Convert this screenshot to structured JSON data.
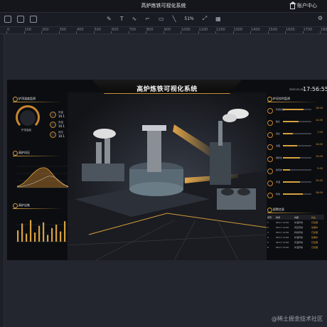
{
  "window": {
    "title": "高炉炼铁可视化系统",
    "account_label": "账户中心"
  },
  "toolbar": {
    "zoom": "51%",
    "left_icons": [
      "menu-icon",
      "layers-icon",
      "undo-icon"
    ],
    "center_icons": [
      "pen-icon",
      "text-icon",
      "curve-icon",
      "connector-icon"
    ],
    "right_icons": [
      "settings-icon"
    ]
  },
  "ruler": {
    "ticks": [
      "0",
      "100",
      "200",
      "300",
      "400",
      "500",
      "600",
      "700",
      "800",
      "900",
      "1000",
      "1100",
      "1200",
      "1300",
      "1400",
      "1500",
      "1600",
      "1700",
      "1800"
    ]
  },
  "dashboard": {
    "title": "高炉炼铁可视化系统",
    "date": "2022-01-05",
    "time": "17:56:55",
    "left_panels": {
      "gauge_title": "炉顶温度监测",
      "gauge_label": "炉顶温度",
      "stats": [
        {
          "label": "风量",
          "value": "10.1"
        },
        {
          "label": "风温",
          "value": "10.1"
        },
        {
          "label": "风压",
          "value": "10.1"
        }
      ],
      "area_title": "高炉风压",
      "bar_title": "高炉出铁",
      "bar_values": [
        0.5,
        0.8,
        0.35,
        0.95,
        0.4,
        0.7,
        0.85,
        0.3,
        0.6,
        0.75,
        0.45,
        0.9
      ]
    },
    "right_panels": {
      "list_title": "炉况实时监测",
      "rows": [
        {
          "label": "利用系数",
          "value": "18.00",
          "pct": 0.72
        },
        {
          "label": "焦比",
          "value": "14.00",
          "pct": 0.55
        },
        {
          "label": "煤比",
          "value": "7.00",
          "pct": 0.35
        },
        {
          "label": "冶强",
          "value": "10.00",
          "pct": 0.5
        },
        {
          "label": "燃料比",
          "value": "15.00",
          "pct": 0.6
        },
        {
          "label": "热风炉",
          "value": "5.00",
          "pct": 0.25
        },
        {
          "label": "风温",
          "value": "15.00",
          "pct": 0.6
        },
        {
          "label": "料线",
          "value": "18.00",
          "pct": 0.7
        }
      ],
      "table_title": "报警信息",
      "table_headers": [
        "序号",
        "时间",
        "内容",
        "状态"
      ],
      "table_rows": [
        [
          "1",
          "08-17 12:00",
          "炉温异常",
          "已处理"
        ],
        [
          "2",
          "08-17 12:00",
          "风压异常",
          "处理中"
        ],
        [
          "3",
          "08-17 12:00",
          "料线异常",
          "已处理"
        ],
        [
          "4",
          "08-17 12:00",
          "炉温异常",
          "处理中"
        ],
        [
          "5",
          "08-17 12:00",
          "风温异常",
          "已处理"
        ],
        [
          "6",
          "08-17 12:00",
          "炉温异常",
          "已处理"
        ]
      ]
    }
  },
  "watermark": "@稀土掘金技术社区",
  "colors": {
    "accent": "#d7a13f",
    "bg": "#1d2028",
    "panel": "#0b0d11"
  }
}
